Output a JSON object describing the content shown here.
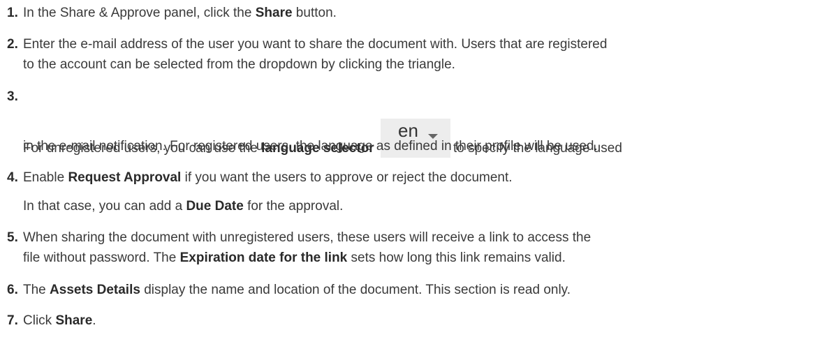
{
  "steps": [
    {
      "num": "1.",
      "lines": [
        {
          "t1": "In the Share & Approve panel, click the ",
          "b1": "Share",
          "t2": " button."
        }
      ]
    },
    {
      "num": "2.",
      "lines": [
        {
          "t1": "Enter the e-mail address of the user you want to share the document with. Users that are registered"
        },
        {
          "t1": "to the account can be selected from the dropdown by clicking the triangle."
        }
      ]
    },
    {
      "num": "3.",
      "lines": [
        {
          "t1": "For unregistered users, you can use the ",
          "b1": "language selector",
          "t2": "to specify the language used"
        },
        {
          "t1": "in the e-mail notification. For registered users, the language as defined in their profile will be used."
        }
      ],
      "language_selector": {
        "value": "en"
      }
    },
    {
      "num": "4.",
      "lines": [
        {
          "t1": "Enable ",
          "b1": "Request Approval",
          "t2": " if you want the users to approve or reject the document."
        },
        {
          "t1": "In that case, you can add a ",
          "b1": "Due Date",
          "t2": " for the approval."
        }
      ]
    },
    {
      "num": "5.",
      "lines": [
        {
          "t1": "When sharing the document with unregistered users, these users will receive a link to access the"
        },
        {
          "t1": "file without password. The ",
          "b1": "Expiration date for the link",
          "t2": " sets how long this link remains valid."
        }
      ]
    },
    {
      "num": "6.",
      "lines": [
        {
          "t1": "The ",
          "b1": "Assets Details",
          "t2": " display the name and location of the document. This section is read only."
        }
      ]
    },
    {
      "num": "7.",
      "lines": [
        {
          "t1": "Click ",
          "b1": "Share",
          "t2": "."
        }
      ]
    }
  ]
}
